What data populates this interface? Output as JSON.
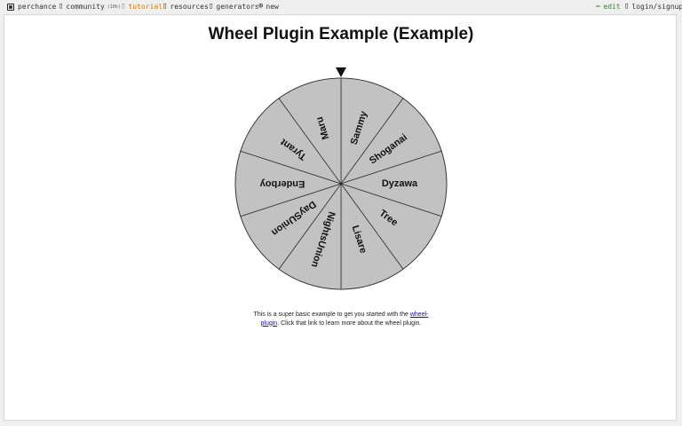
{
  "nav": {
    "site": "perchance",
    "community": "community",
    "community_badge": "(10h)",
    "tutorial": "tutorial",
    "resources": "resources",
    "generators": "generators",
    "new": "new",
    "edit": "edit",
    "login": "login/signup"
  },
  "page": {
    "title": "Wheel Plugin Example (Example)",
    "note_before": "This is a super basic example to get you started with the ",
    "link_text_1": "wheel-",
    "link_text_2": "plugin",
    "note_after": ". Click that link to learn more about the wheel plugin."
  },
  "wheel": {
    "items": [
      "Sammy",
      "Shoganai",
      "Dyzawa",
      "Tree",
      "Lisare",
      "NightsUnion",
      "DaySUnion",
      "Enderboy",
      "Tyrant",
      "Maru"
    ],
    "fill_color": "#c2c2c2",
    "line_color": "#333333"
  },
  "colors": {
    "accent_orange": "#e07b00",
    "edit_green": "#2e8b2e",
    "link_blue": "#1a0dab"
  }
}
